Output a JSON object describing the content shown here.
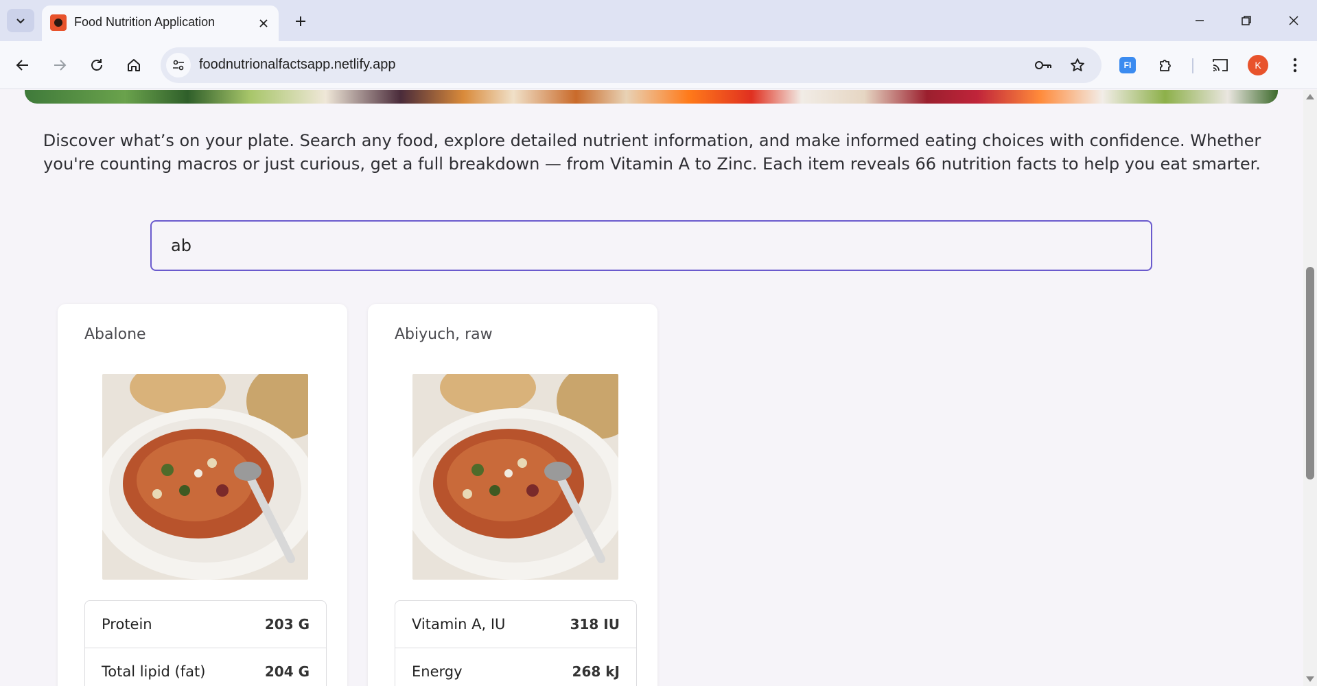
{
  "browser": {
    "tab_title": "Food Nutrition Application",
    "url": "foodnutrionalfactsapp.netlify.app",
    "profile_initial": "K",
    "extension_label": "FI"
  },
  "page": {
    "intro_text": "Discover what’s on your plate. Search any food, explore detailed nutrient information, and make informed eating choices with confidence. Whether you're counting macros or just curious, get a full breakdown — from Vitamin A to Zinc. Each item reveals 66 nutrition facts to help you eat smarter.",
    "search_value": "ab",
    "results": [
      {
        "name": "Abalone",
        "nutrients": [
          {
            "label": "Protein",
            "value": "203 G"
          },
          {
            "label": "Total lipid (fat)",
            "value": "204 G"
          }
        ]
      },
      {
        "name": "Abiyuch, raw",
        "nutrients": [
          {
            "label": "Vitamin A, IU",
            "value": "318 IU"
          },
          {
            "label": "Energy",
            "value": "268 kJ"
          }
        ]
      }
    ]
  },
  "colors": {
    "accent": "#6a5acd",
    "page_bg": "#f6f4f9",
    "tabbar_bg": "#dfe3f3",
    "avatar_bg": "#e8532c"
  }
}
